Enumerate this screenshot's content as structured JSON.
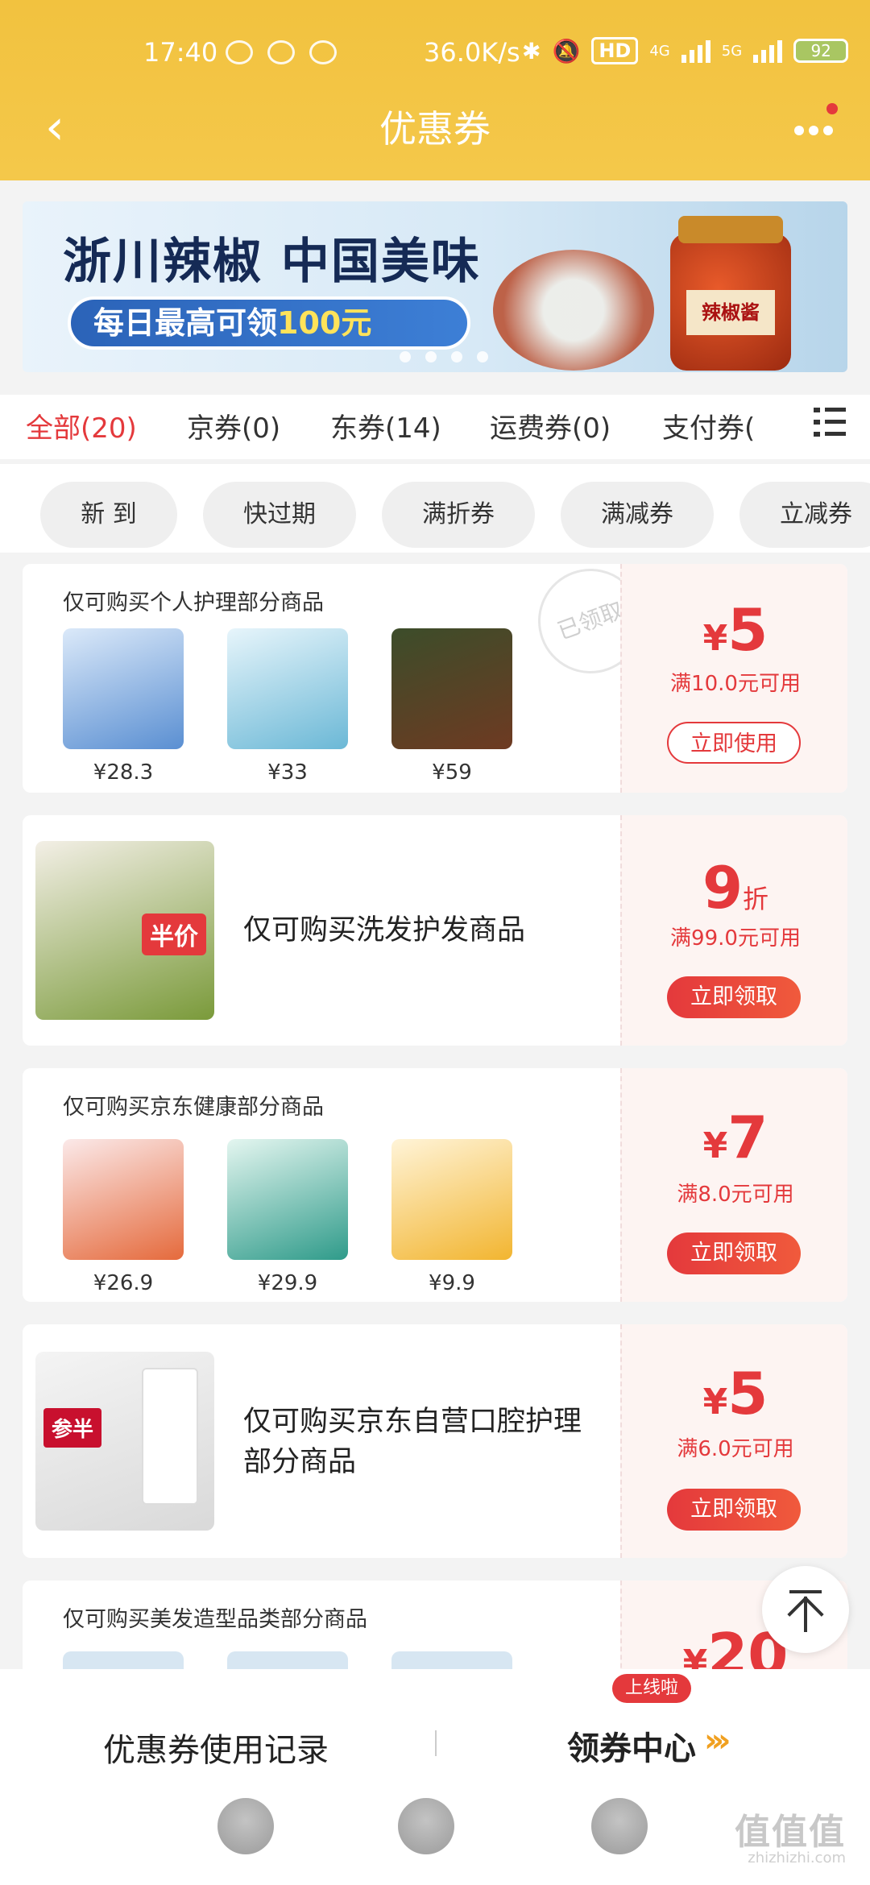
{
  "status_bar": {
    "time": "17:40",
    "speed": "36.0K/s",
    "hd": "HD",
    "net1": "4G",
    "net2": "5G",
    "battery": "92"
  },
  "header": {
    "title": "优惠券",
    "back_icon": "back-chevron-icon",
    "more_icon": "more-dots-icon"
  },
  "banner": {
    "headline": "浙川辣椒 中国美味",
    "pill_prefix": "每日最高可领",
    "pill_amount": "100元",
    "jar_label": "辣椒酱"
  },
  "tabs": [
    {
      "label": "全部(20)"
    },
    {
      "label": "京券(0)"
    },
    {
      "label": "东券(14)"
    },
    {
      "label": "运费券(0)"
    },
    {
      "label": "支付券("
    }
  ],
  "filters": [
    {
      "label": "新 到"
    },
    {
      "label": "快过期"
    },
    {
      "label": "满折券"
    },
    {
      "label": "满减券"
    },
    {
      "label": "立减券"
    }
  ],
  "coupons": [
    {
      "desc": "仅可购买个人护理部分商品",
      "stamp": "已领取",
      "prices": [
        "¥28.3",
        "¥33",
        "¥59"
      ],
      "currency": "¥",
      "amount": "5",
      "condition": "满10.0元可用",
      "button": "立即使用"
    },
    {
      "title": "仅可购买洗发护发商品",
      "amount": "9",
      "unit": "折",
      "condition": "满99.0元可用",
      "button": "立即领取",
      "img_label": "半价"
    },
    {
      "desc": "仅可购买京东健康部分商品",
      "prices": [
        "¥26.9",
        "¥29.9",
        "¥9.9"
      ],
      "currency": "¥",
      "amount": "7",
      "condition": "满8.0元可用",
      "button": "立即领取"
    },
    {
      "title": "仅可购买京东自营口腔护理部分商品",
      "currency": "¥",
      "amount": "5",
      "condition": "满6.0元可用",
      "button": "立即领取",
      "img_label": "参半"
    },
    {
      "desc": "仅可购买美发造型品类部分商品",
      "currency": "¥",
      "amount": "20"
    }
  ],
  "bottom_bar": {
    "history": "优惠券使用记录",
    "center": "领券中心",
    "center_badge": "上线啦",
    "chevrons": "›››",
    "watermark": "值值值",
    "watermark_url": "zhizhizhi.com"
  }
}
